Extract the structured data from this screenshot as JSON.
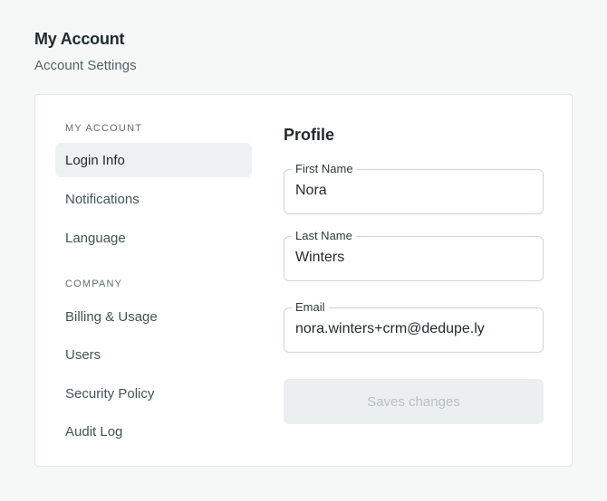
{
  "header": {
    "title": "My Account",
    "subtitle": "Account Settings"
  },
  "sidebar": {
    "sections": [
      {
        "label": "MY ACCOUNT",
        "items": [
          "Login Info",
          "Notifications",
          "Language"
        ]
      },
      {
        "label": "COMPANY",
        "items": [
          "Billing & Usage",
          "Users",
          "Security Policy",
          "Audit Log"
        ]
      }
    ],
    "active_item": "Login Info"
  },
  "profile": {
    "title": "Profile",
    "fields": [
      {
        "label": "First Name",
        "value": "Nora"
      },
      {
        "label": "Last Name",
        "value": "Winters"
      },
      {
        "label": "Email",
        "value": "nora.winters+crm@dedupe.ly"
      }
    ],
    "save_label": "Saves changes",
    "save_enabled": false
  },
  "colors": {
    "background": "#f6f7f7",
    "card": "#ffffff",
    "active_nav": "#eef1f1",
    "text_primary": "#1f2a2b",
    "text_secondary": "#4e6466",
    "button_disabled_bg": "#eceff0",
    "button_disabled_text": "#b7c1c2"
  }
}
